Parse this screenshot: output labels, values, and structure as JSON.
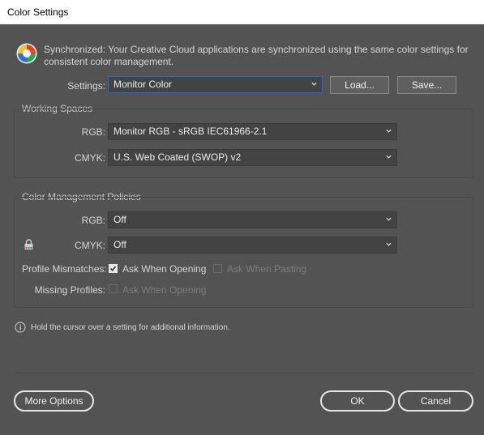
{
  "window": {
    "title": "Color Settings"
  },
  "sync": {
    "message_line1": "Synchronized: Your Creative Cloud applications are synchronized using the same color settings for",
    "message_line2": "consistent color management.",
    "icon": "color-wheel-icon"
  },
  "settings": {
    "label": "Settings:",
    "value": "Monitor Color",
    "load_label": "Load...",
    "save_label": "Save..."
  },
  "working_spaces": {
    "title": "Working Spaces",
    "rgb_label": "RGB:",
    "rgb_value": "Monitor RGB - sRGB IEC61966-2.1",
    "cmyk_label": "CMYK:",
    "cmyk_value": "U.S. Web Coated (SWOP) v2"
  },
  "policies": {
    "title": "Color Management Policies",
    "rgb_label": "RGB:",
    "rgb_value": "Off",
    "cmyk_label": "CMYK:",
    "cmyk_value": "Off",
    "mismatch_label": "Profile Mismatches:",
    "ask_opening_label": "Ask When Opening",
    "ask_opening_checked": true,
    "ask_pasting_label": "Ask When Pasting",
    "ask_pasting_checked": false,
    "missing_label": "Missing Profiles:",
    "missing_ask_opening_label": "Ask When Opening",
    "missing_ask_opening_checked": false
  },
  "info": {
    "text": "Hold the cursor over a setting for additional information."
  },
  "footer": {
    "more_options_label": "More Options",
    "ok_label": "OK",
    "cancel_label": "Cancel"
  },
  "colors": {
    "focus_border": "#1f6fd2",
    "background": "#535353",
    "field": "#434343"
  }
}
